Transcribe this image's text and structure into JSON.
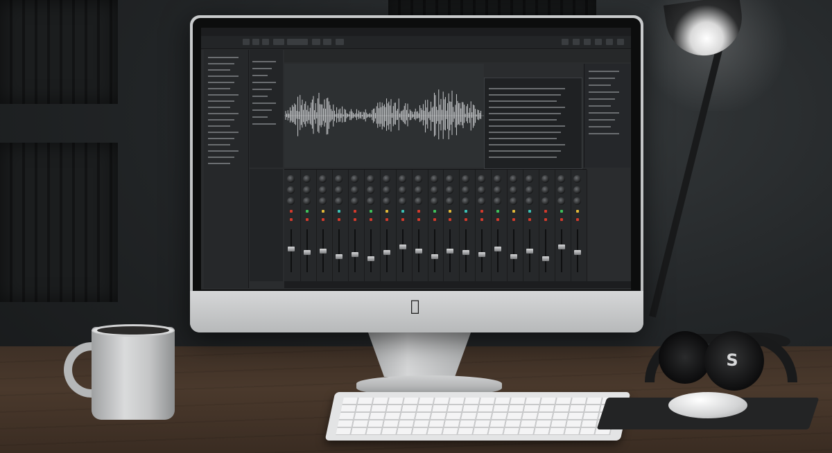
{
  "scene": {
    "description_items": [
      "monitor",
      "lamp",
      "mug",
      "keyboard",
      "mouse",
      "headphones"
    ]
  },
  "screen": {
    "app_title": "",
    "menu_items": [
      "",
      "",
      "",
      "",
      "",
      "",
      ""
    ],
    "wave_header_labels": [
      "",
      "",
      "",
      "",
      ""
    ],
    "inspector_title": "",
    "mixer_label": ""
  },
  "colors": {
    "led_red": "#d23a2c",
    "led_green": "#3fbf5a",
    "led_yellow": "#e0b93a",
    "led_teal": "#3cc0b5"
  },
  "icons": {
    "apple": "apple-logo-icon",
    "headphone_logo": "headphone-brand-icon"
  },
  "mixer": {
    "channel_count": 19,
    "fader_levels": [
      0.55,
      0.45,
      0.5,
      0.35,
      0.4,
      0.3,
      0.45,
      0.6,
      0.5,
      0.35,
      0.5,
      0.45,
      0.4,
      0.55,
      0.35,
      0.5,
      0.3,
      0.6,
      0.45
    ]
  }
}
